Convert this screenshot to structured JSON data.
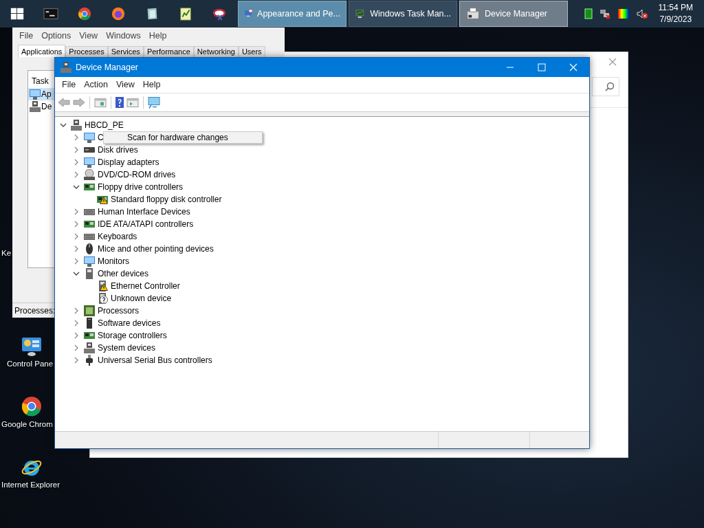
{
  "taskbar": {
    "buttons": [
      {
        "label": "Appearance and Pe...",
        "selected": false,
        "hovered": true
      },
      {
        "label": "Windows Task Man...",
        "selected": false,
        "hovered": false
      },
      {
        "label": "Device Manager",
        "selected": true,
        "hovered": false
      }
    ],
    "clock": {
      "time": "11:54 PM",
      "date": "7/9/2023"
    }
  },
  "desktop_icons": [
    {
      "label": "Ke"
    },
    {
      "label": "Control Pane"
    },
    {
      "label": "Google Chrom"
    },
    {
      "label": "Internet Explorer"
    }
  ],
  "task_manager": {
    "menu": [
      "File",
      "Options",
      "View",
      "Windows",
      "Help"
    ],
    "tabs": [
      {
        "label": "Applications",
        "selected": true
      },
      {
        "label": "Processes",
        "selected": false
      },
      {
        "label": "Services",
        "selected": false
      },
      {
        "label": "Performance",
        "selected": false
      },
      {
        "label": "Networking",
        "selected": false
      },
      {
        "label": "Users",
        "selected": false
      }
    ],
    "column": "Task",
    "rows": [
      {
        "label": "Ap",
        "selected": true
      },
      {
        "label": "De",
        "selected": false
      }
    ],
    "status": "Processes:"
  },
  "device_manager": {
    "title": "Device Manager",
    "menu": [
      "File",
      "Action",
      "View",
      "Help"
    ],
    "tree": [
      {
        "label": "HBCD_PE",
        "expanded": true,
        "children": [
          {
            "label": "C",
            "expanded": false
          },
          {
            "label": "Disk drives",
            "expanded": false
          },
          {
            "label": "Display adapters",
            "expanded": false
          },
          {
            "label": "DVD/CD-ROM drives",
            "expanded": false
          },
          {
            "label": "Floppy drive controllers",
            "expanded": true,
            "children": [
              {
                "label": "Standard floppy disk controller",
                "warning": true,
                "unknown": false
              }
            ]
          },
          {
            "label": "Human Interface Devices",
            "expanded": false
          },
          {
            "label": "IDE ATA/ATAPI controllers",
            "expanded": false
          },
          {
            "label": "Keyboards",
            "expanded": false
          },
          {
            "label": "Mice and other pointing devices",
            "expanded": false
          },
          {
            "label": "Monitors",
            "expanded": false
          },
          {
            "label": "Other devices",
            "expanded": true,
            "children": [
              {
                "label": "Ethernet Controller",
                "warning": true,
                "unknown": false
              },
              {
                "label": "Unknown device",
                "warning": false,
                "unknown": true
              }
            ]
          },
          {
            "label": "Processors",
            "expanded": false
          },
          {
            "label": "Software devices",
            "expanded": false
          },
          {
            "label": "Storage controllers",
            "expanded": false
          },
          {
            "label": "System devices",
            "expanded": false
          },
          {
            "label": "Universal Serial Bus controllers",
            "expanded": false
          }
        ]
      }
    ],
    "context_menu": [
      "Scan for hardware changes"
    ]
  }
}
